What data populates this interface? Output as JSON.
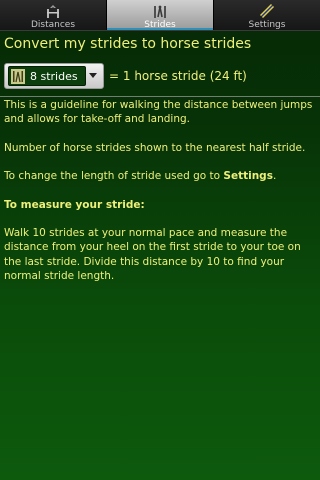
{
  "tabs": [
    {
      "label": "Distances",
      "icon": "horse-jump-icon",
      "active": false
    },
    {
      "label": "Strides",
      "icon": "stride-icon",
      "active": true
    },
    {
      "label": "Settings",
      "icon": "ribbon-icon",
      "active": false
    }
  ],
  "converter": {
    "heading": "Convert my strides to horse strides",
    "spinner_value": "8 strides",
    "result_text": "= 1 horse stride (24 ft)"
  },
  "info": {
    "guideline": "This is a guideline for walking the distance between jumps and allows for take-off and landing.",
    "rounding": "Number of horse strides shown to the nearest half stride.",
    "change_prefix": "To change the length of stride used go to ",
    "change_link": "Settings",
    "change_suffix": ".",
    "measure_title": "To measure your stride:",
    "measure_text": "Walk 10 strides at your normal pace and measure the distance from your heel on the first stride to your toe on the last stride. Divide this distance by 10 to find your normal stride length."
  },
  "colors": {
    "text": "#eef07a",
    "background_top": "#062806",
    "background_bottom": "#0d5a0d",
    "tab_active_indicator": "#2f8fb8"
  }
}
